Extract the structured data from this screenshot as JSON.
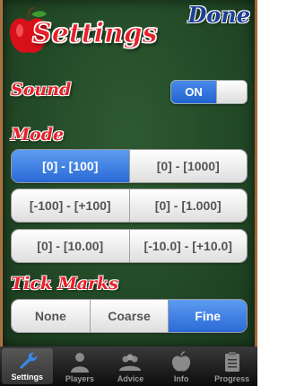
{
  "header": {
    "title": "Settings",
    "done_label": "Done"
  },
  "sound": {
    "label": "Sound",
    "toggle_label": "ON",
    "on": true
  },
  "mode": {
    "label": "Mode",
    "options": [
      "[0] - [100]",
      "[0] - [1000]",
      "[-100] - [+100]",
      "[0] - [1.000]",
      "[0] - [10.00]",
      "[-10.0] - [+10.0]"
    ],
    "selected": "[0] - [100]"
  },
  "tick_marks": {
    "label": "Tick Marks",
    "options": [
      "None",
      "Coarse",
      "Fine"
    ],
    "selected": "Fine"
  },
  "tabbar": {
    "tabs": [
      {
        "label": "Settings",
        "icon": "wrench-icon",
        "active": true
      },
      {
        "label": "Players",
        "icon": "person-icon",
        "active": false
      },
      {
        "label": "Advice",
        "icon": "people-icon",
        "active": false
      },
      {
        "label": "Info",
        "icon": "apple-icon",
        "active": false
      },
      {
        "label": "Progress",
        "icon": "clipboard-icon",
        "active": false
      }
    ]
  },
  "colors": {
    "accent_red": "#e8202a",
    "accent_blue": "#2b6ad6",
    "board_green": "#2e5a32"
  }
}
